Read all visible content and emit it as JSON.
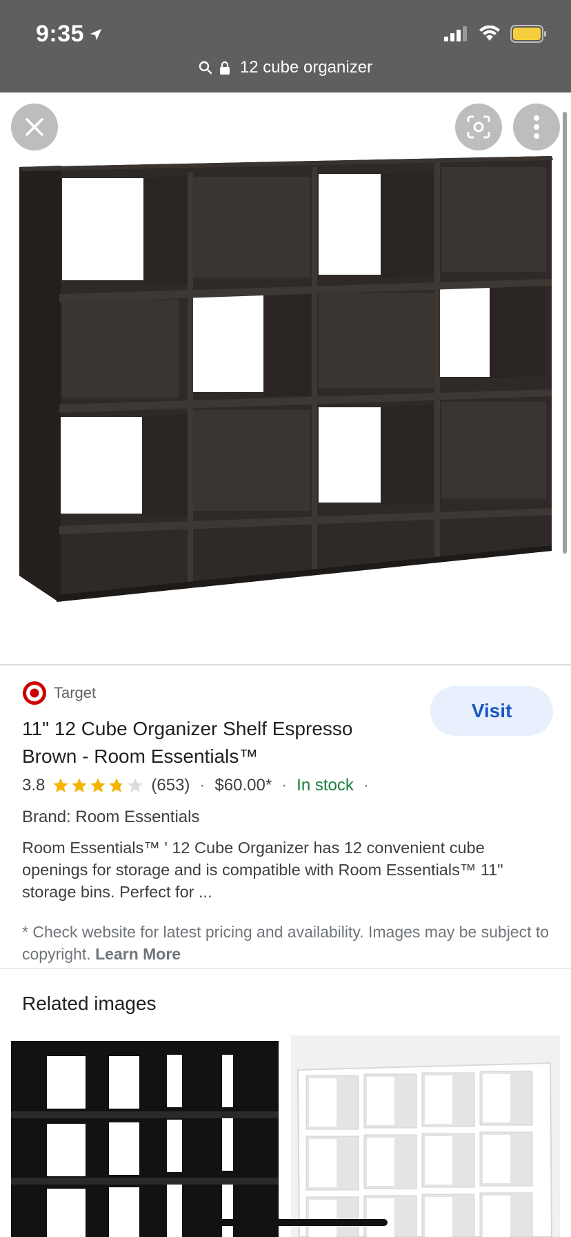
{
  "status_bar": {
    "time": "9:35"
  },
  "url_bar": {
    "text": "12 cube organizer"
  },
  "product": {
    "source": "Target",
    "visit_label": "Visit",
    "title": "11\" 12 Cube Organizer Shelf Espresso Brown - Room Essentials™",
    "rating": "3.8",
    "rating_value": 3.8,
    "reviews": "(653)",
    "price": "$60.00*",
    "availability": "In stock",
    "brand": "Brand: Room Essentials",
    "description": "Room Essentials™ ' 12 Cube Organizer has 12 convenient cube openings for storage and is compatible with Room Essentials™ 11\" storage bins. Perfect for ...",
    "note": "* Check website for latest pricing and availability. Images may be subject to copyright.",
    "learn_more": "Learn More"
  },
  "related": {
    "title": "Related images"
  },
  "colors": {
    "accent": "#1a56c4",
    "in_stock": "#188038",
    "star": "#f4b400",
    "shelf": "#2f2a28"
  },
  "icons": [
    "location-arrow-icon",
    "signal-icon",
    "wifi-icon",
    "battery-icon",
    "search-icon",
    "lock-icon",
    "close-icon",
    "lens-icon",
    "more-vert-icon",
    "target-logo-icon",
    "star-icon"
  ]
}
